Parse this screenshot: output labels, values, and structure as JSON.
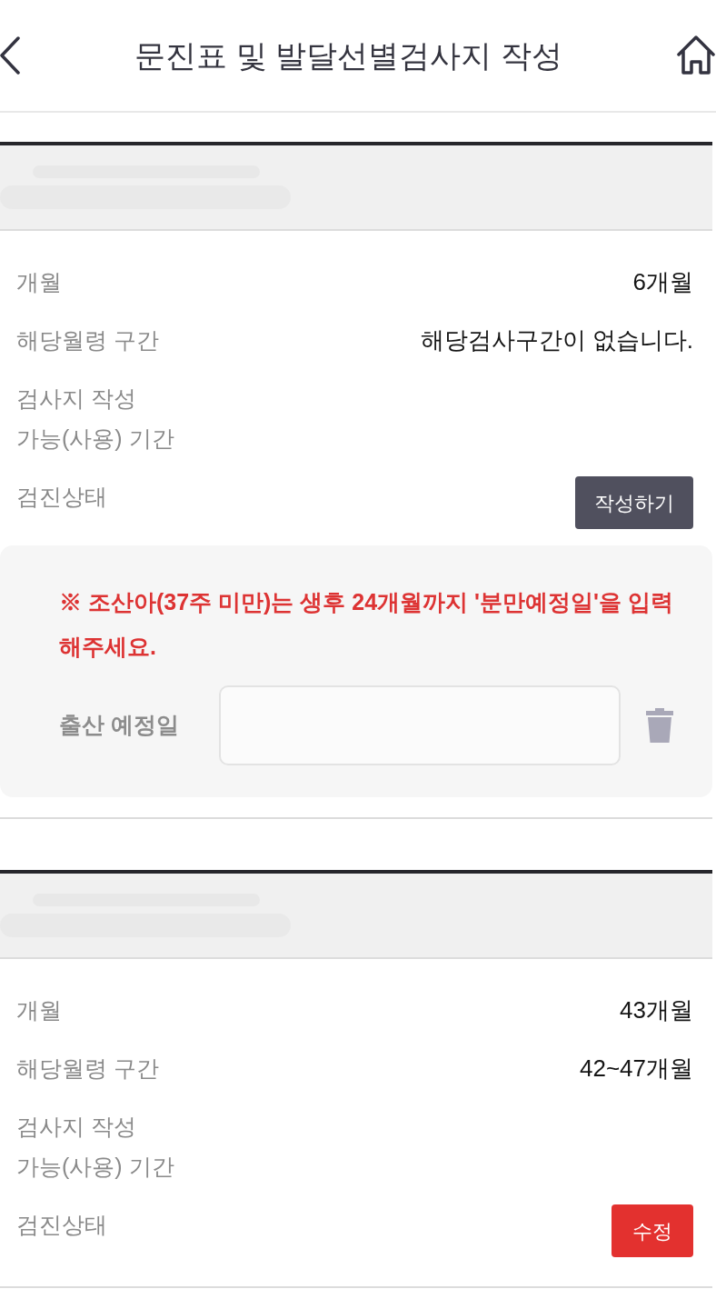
{
  "header": {
    "title": "문진표 및 발달선별검사지 작성"
  },
  "records": [
    {
      "rows": [
        {
          "label": "개월",
          "value": "6개월"
        },
        {
          "label": "해당월령 구간",
          "value": "해당검사구간이 없습니다."
        },
        {
          "label": "검사지 작성\n가능(사용) 기간"
        }
      ],
      "status": {
        "label": "검진상태",
        "button": {
          "label": "작성하기",
          "kind": "write"
        }
      },
      "notice": {
        "message": "※ 조산아(37주 미만)는 생후 24개월까지 '분만예정일'을 입력해주세요.",
        "field_label": "출산 예정일"
      }
    },
    {
      "rows": [
        {
          "label": "개월",
          "value": "43개월"
        },
        {
          "label": "해당월령 구간",
          "value": "42~47개월"
        },
        {
          "label": "검사지 작성\n가능(사용) 기간"
        }
      ],
      "status": {
        "label": "검진상태",
        "button": {
          "label": "수정",
          "kind": "edit"
        }
      }
    }
  ]
}
